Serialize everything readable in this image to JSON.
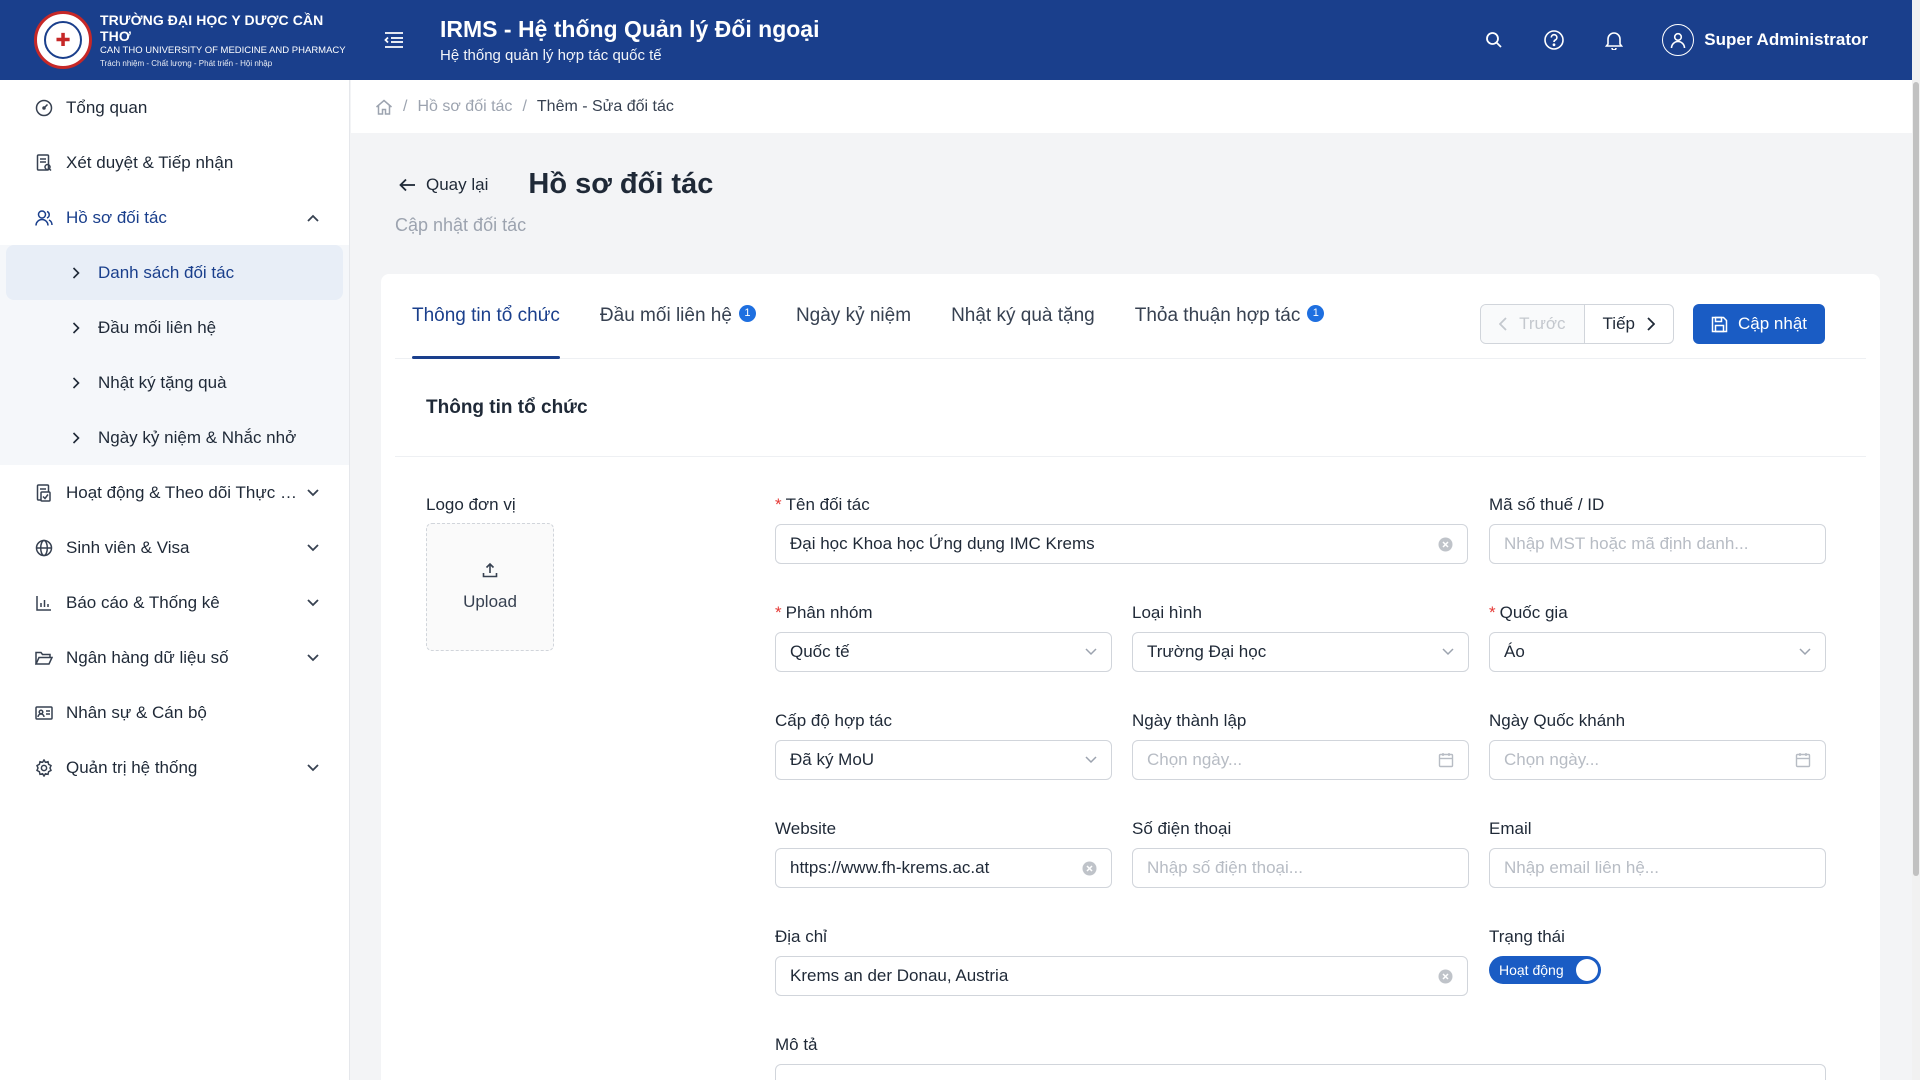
{
  "header": {
    "logo_line1": "TRƯỜNG ĐẠI HỌC Y DƯỢC CẦN THƠ",
    "logo_line2": "CAN THO UNIVERSITY OF MEDICINE AND PHARMACY",
    "logo_line3": "Trách nhiệm - Chất lượng - Phát triển - Hội nhập",
    "title": "IRMS - Hệ thống Quản lý Đối ngoại",
    "subtitle": "Hệ thống quản lý hợp tác quốc tế",
    "user_name": "Super Administrator"
  },
  "sidebar": {
    "items": [
      {
        "label": "Tổng quan"
      },
      {
        "label": "Xét duyệt & Tiếp nhận"
      },
      {
        "label": "Hồ sơ đối tác"
      },
      {
        "label": "Hoạt động & Theo dõi Thực hiện"
      },
      {
        "label": "Sinh viên & Visa"
      },
      {
        "label": "Báo cáo & Thống kê"
      },
      {
        "label": "Ngân hàng dữ liệu số"
      },
      {
        "label": "Nhân sự & Cán bộ"
      },
      {
        "label": "Quản trị hệ thống"
      }
    ],
    "sub_items": [
      {
        "label": "Danh sách đối tác"
      },
      {
        "label": "Đầu mối liên hệ"
      },
      {
        "label": "Nhật ký tặng quà"
      },
      {
        "label": "Ngày kỷ niệm & Nhắc nhở"
      }
    ]
  },
  "breadcrumb": {
    "items": [
      "Hồ sơ đối tác",
      "Thêm - Sửa đối tác"
    ]
  },
  "page": {
    "back_label": "Quay lại",
    "title": "Hồ sơ đối tác",
    "subtitle": "Cập nhật đối tác"
  },
  "tabs": [
    {
      "label": "Thông tin tổ chức",
      "badge": ""
    },
    {
      "label": "Đầu mối liên hệ",
      "badge": "1"
    },
    {
      "label": "Ngày kỷ niệm",
      "badge": ""
    },
    {
      "label": "Nhật ký quà tặng",
      "badge": ""
    },
    {
      "label": "Thỏa thuận hợp tác",
      "badge": "1"
    }
  ],
  "pager": {
    "prev": "Trước",
    "next": "Tiếp"
  },
  "update_label": "Cập nhật",
  "section_title": "Thông tin tổ chức",
  "form": {
    "logo_label": "Logo đơn vị",
    "upload_label": "Upload",
    "partner_name": {
      "label": "Tên đối tác",
      "value": "Đại học Khoa học Ứng dụng IMC Krems"
    },
    "tax_id": {
      "label": "Mã số thuế / ID",
      "placeholder": "Nhập MST hoặc mã định danh..."
    },
    "group": {
      "label": "Phân nhóm",
      "value": "Quốc tế"
    },
    "type": {
      "label": "Loại hình",
      "value": "Trường Đại học"
    },
    "country": {
      "label": "Quốc gia",
      "value": "Áo"
    },
    "level": {
      "label": "Cấp độ hợp tác",
      "value": "Đã ký MoU"
    },
    "founded": {
      "label": "Ngày thành lập",
      "placeholder": "Chọn ngày..."
    },
    "national_day": {
      "label": "Ngày Quốc khánh",
      "placeholder": "Chọn ngày..."
    },
    "website": {
      "label": "Website",
      "value": "https://www.fh-krems.ac.at"
    },
    "phone": {
      "label": "Số điện thoại",
      "placeholder": "Nhập số điện thoại..."
    },
    "email": {
      "label": "Email",
      "placeholder": "Nhập email liên hệ..."
    },
    "address": {
      "label": "Địa chỉ",
      "value": "Krems an der Donau, Austria"
    },
    "status": {
      "label": "Trạng thái",
      "value": "Hoạt động"
    },
    "description": {
      "label": "Mô tả"
    }
  },
  "colors": {
    "header_bg": "#1a3f8c",
    "primary": "#1a5cc4",
    "required": "#e53935",
    "badge": "#1e6fe0"
  }
}
